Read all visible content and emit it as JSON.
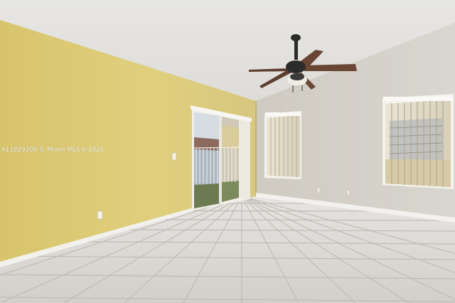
{
  "photo": {
    "watermark": "A11829309 © Miami MLS® 2025",
    "colors": {
      "ceiling": "#e6e5e3",
      "left_wall": "#dccb78",
      "right_wall": "#d6d2cb",
      "floor_tile": "#d9d7d3",
      "grout": "#bdb9b2",
      "baseboard": "#f2f1ee",
      "fan_blade": "#6a4634",
      "fan_body": "#2b2b2b",
      "blinds": "#e3dccb"
    },
    "icons": [
      "ceiling-fan",
      "sliding-glass-door",
      "window-blinds",
      "power-outlet",
      "light-switch"
    ]
  }
}
